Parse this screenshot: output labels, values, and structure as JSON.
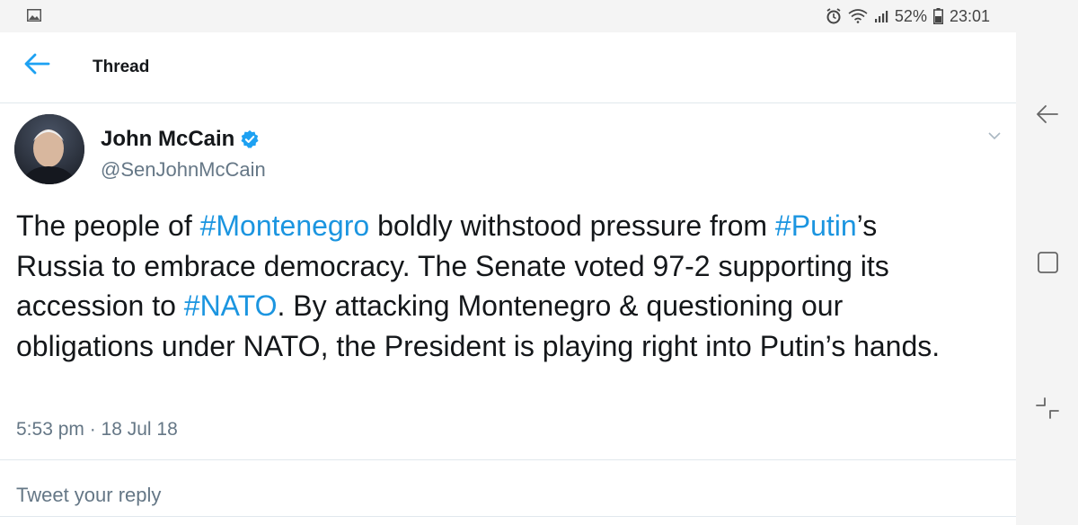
{
  "status_bar": {
    "battery": "52%",
    "time": "23:01",
    "icons": [
      "image-icon",
      "alarm-icon",
      "wifi-icon",
      "signal-icon",
      "battery-icon"
    ]
  },
  "app_bar": {
    "title": "Thread",
    "back_icon": "arrow-left-icon"
  },
  "tweet": {
    "author_name": "John McCain",
    "author_handle": "@SenJohnMcCain",
    "verified": true,
    "text_parts": {
      "p1": "The people of ",
      "tag1": "#Montenegro",
      "p2": " boldly withstood pressure from ",
      "tag2": "#Putin",
      "p3": "’s Russia to embrace democracy. The Senate voted 97-2 supporting its accession to ",
      "tag3": "#NATO",
      "p4": ". By attacking Montenegro & questioning our obligations under NATO, the President is playing right into Putin’s hands."
    },
    "timestamp": "5:53 pm · 18 Jul 18"
  },
  "reply": {
    "placeholder": "Tweet your reply"
  },
  "nav_bar": {
    "buttons": [
      "back-nav-icon",
      "home-nav-icon",
      "recents-nav-icon"
    ]
  },
  "colors": {
    "link": "#1b95e0",
    "text": "#14171a",
    "secondary": "#657786"
  }
}
